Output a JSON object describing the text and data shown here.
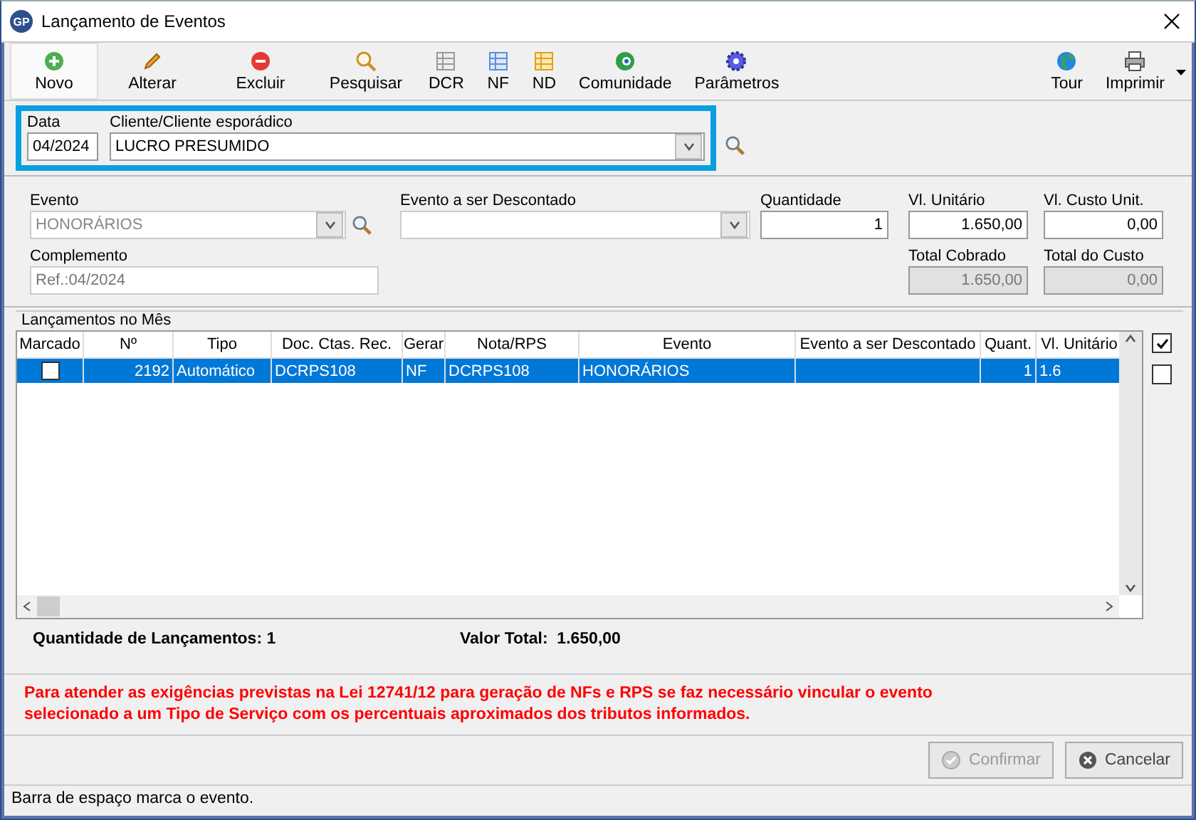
{
  "window": {
    "title": "Lançamento de Eventos",
    "logo": "GP"
  },
  "toolbar": [
    {
      "label": "Novo",
      "selected": true
    },
    {
      "label": "Alterar",
      "selected": false
    },
    {
      "label": "Excluir",
      "selected": false
    },
    {
      "label": "Pesquisar",
      "selected": false
    },
    {
      "label": "DCR",
      "selected": false
    },
    {
      "label": "NF",
      "selected": false
    },
    {
      "label": "ND",
      "selected": false
    },
    {
      "label": "Comunidade",
      "selected": false
    },
    {
      "label": "Parâmetros",
      "selected": false
    }
  ],
  "toolbar_right": [
    {
      "label": "Tour",
      "selected": false
    },
    {
      "label": "Imprimir",
      "selected": false
    }
  ],
  "client": {
    "date_label": "Data",
    "date": "04/2024",
    "client_label": "Cliente/Cliente esporádico",
    "client": "LUCRO PRESUMIDO"
  },
  "event": {
    "evento_label": "Evento",
    "evento": "HONORÁRIOS",
    "evento_disabled": true,
    "desc_label": "Evento a ser Descontado",
    "quantidade_label": "Quantidade",
    "quantidade": "1",
    "unit_label": "Vl. Unitário",
    "unit": "1.650,00",
    "custo_label": "Vl. Custo Unit.",
    "custo": "0,00",
    "complemento_label": "Complemento",
    "complemento": "Ref.:04/2024",
    "complemento_disabled": true,
    "total_label": "Total Cobrado",
    "total": "1.650,00",
    "total_custo_label": "Total do Custo",
    "total_custo": "0,00"
  },
  "grid": {
    "title": "Lançamentos no Mês",
    "columns": [
      "Marcado",
      "Nº",
      "Tipo",
      "Doc. Ctas. Rec.",
      "Gerar",
      "Nota/RPS",
      "Evento",
      "Evento a ser Descontado",
      "Quant.",
      "Vl. Unitário"
    ],
    "rows": [
      {
        "selected": true,
        "cells": [
          {
            "kind": "checkbox",
            "checked": false
          },
          "2192",
          "Automático",
          "DCRPS108",
          "NF",
          "DCRPS108",
          "HONORÁRIOS",
          null,
          "1",
          "1.6"
        ]
      }
    ],
    "side_checks": [
      {
        "checked": true
      },
      {
        "checked": false
      }
    ]
  },
  "totals": {
    "count_label": "Quantidade de Lançamentos:",
    "count": "1",
    "value_label": "Valor Total:",
    "value": "1.650,00"
  },
  "warning": "Para atender as exigências previstas na Lei 12741/12 para geração de NFs e RPS se faz necessário vincular o evento selecionado a um Tipo de Serviço com os percentuais aproximados dos tributos informados.",
  "buttons": [
    {
      "label": "Confirmar",
      "kind": "confirm",
      "disabled": true
    },
    {
      "label": "Cancelar",
      "kind": "cancel",
      "disabled": false
    }
  ],
  "status_bar": "Barra de espaço marca o evento."
}
